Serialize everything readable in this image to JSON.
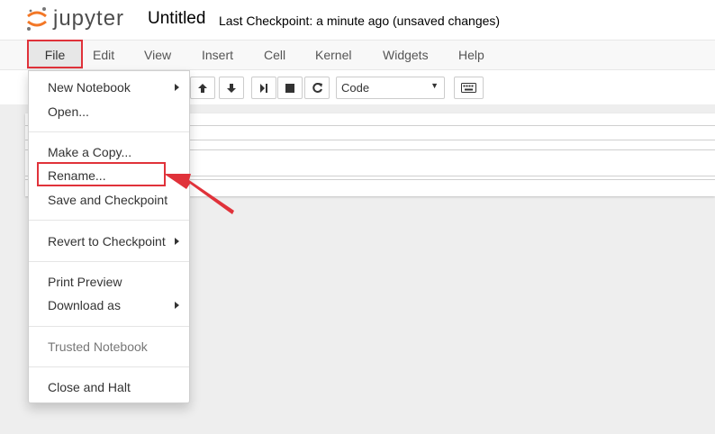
{
  "header": {
    "logo_text": "jupyter",
    "notebook_title": "Untitled",
    "checkpoint_status": "Last Checkpoint: a minute ago (unsaved changes)"
  },
  "menubar": {
    "items": [
      "File",
      "Edit",
      "View",
      "Insert",
      "Cell",
      "Kernel",
      "Widgets",
      "Help"
    ]
  },
  "toolbar": {
    "cell_type": "Code",
    "buttons": [
      "arrow-up-icon",
      "arrow-down-icon",
      "run-icon",
      "stop-icon",
      "restart-icon",
      "keyboard-icon"
    ]
  },
  "file_menu": {
    "items": {
      "new_notebook": "New Notebook",
      "open": "Open...",
      "make_copy": "Make a Copy...",
      "rename": "Rename...",
      "save_checkpoint": "Save and Checkpoint",
      "revert": "Revert to Checkpoint",
      "print_preview": "Print Preview",
      "download_as": "Download as",
      "trusted": "Trusted Notebook",
      "close_halt": "Close and Halt"
    }
  },
  "colors": {
    "highlight": "#e0323a",
    "logo_orange": "#f37726",
    "logo_gray": "#767677"
  }
}
